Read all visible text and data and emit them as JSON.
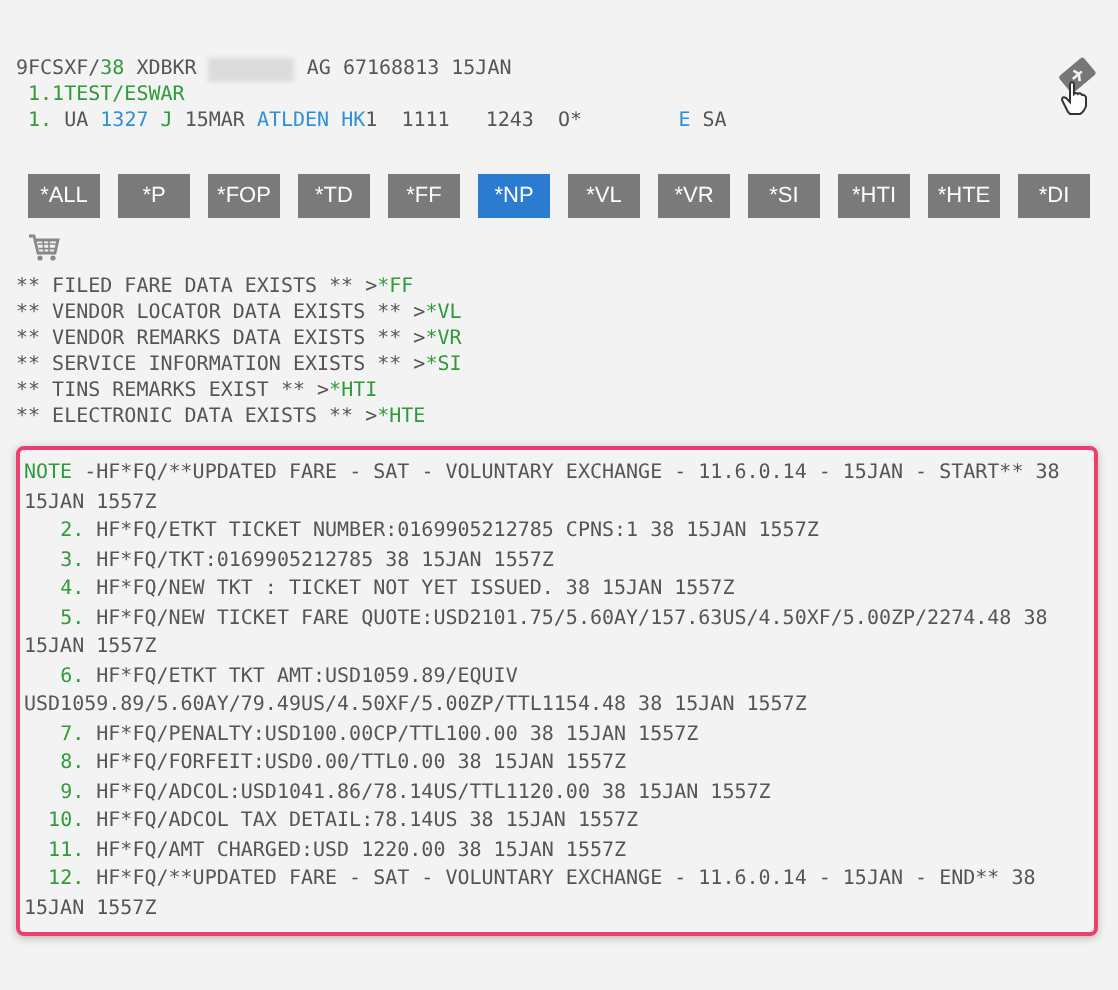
{
  "header_lines": [
    [
      {
        "text": "9FCSXF/",
        "color": "#555555"
      },
      {
        "text": "38",
        "color": "#2e9a3a"
      },
      {
        "text": " XDBKR ",
        "color": "#555555"
      },
      {
        "redacted": true
      },
      {
        "text": " AG 67168813 15JAN",
        "color": "#555555"
      }
    ],
    [
      {
        "text": " 1.1TEST/ESWAR",
        "color": "#2e9a3a"
      }
    ],
    [
      {
        "text": " 1.",
        "color": "#2e9a3a"
      },
      {
        "text": " UA ",
        "color": "#555555"
      },
      {
        "text": "1327",
        "color": "#2f8fd8"
      },
      {
        "text": " J",
        "color": "#2e9a3a"
      },
      {
        "text": " 15MAR ",
        "color": "#555555"
      },
      {
        "text": "ATLDEN HK",
        "color": "#2f8fd8"
      },
      {
        "text": "1  1111   1243  O*        ",
        "color": "#555555"
      },
      {
        "text": "E",
        "color": "#2f8fd8"
      },
      {
        "text": " SA",
        "color": "#555555"
      }
    ]
  ],
  "buttons": [
    {
      "label": "*ALL",
      "selected": false
    },
    {
      "label": "*P",
      "selected": false
    },
    {
      "label": "*FOP",
      "selected": false
    },
    {
      "label": "*TD",
      "selected": false
    },
    {
      "label": "*FF",
      "selected": false
    },
    {
      "label": "*NP",
      "selected": true
    },
    {
      "label": "*VL",
      "selected": false
    },
    {
      "label": "*VR",
      "selected": false
    },
    {
      "label": "*SI",
      "selected": false
    },
    {
      "label": "*HTI",
      "selected": false
    },
    {
      "label": "*HTE",
      "selected": false
    },
    {
      "label": "*DI",
      "selected": false
    }
  ],
  "info_lines": [
    {
      "text": "** FILED FARE DATA EXISTS ** >",
      "command": "*FF"
    },
    {
      "text": "** VENDOR LOCATOR DATA EXISTS ** >",
      "command": "*VL"
    },
    {
      "text": "** VENDOR REMARKS DATA EXISTS ** >",
      "command": "*VR"
    },
    {
      "text": "** SERVICE INFORMATION EXISTS ** >",
      "command": "*SI"
    },
    {
      "text": "** TINS REMARKS EXIST ** >",
      "command": "*HTI"
    },
    {
      "text": "** ELECTRONIC DATA EXISTS ** >",
      "command": "*HTE"
    }
  ],
  "notes": [
    {
      "marker": "NOTE",
      "text": " -HF*FQ/**UPDATED FARE - SAT - VOLUNTARY EXCHANGE - 11.6.0.14 - 15JAN - START** 38 15JAN 1557Z"
    },
    {
      "marker": "   2.",
      "text": " HF*FQ/ETKT TICKET NUMBER:0169905212785 CPNS:1 38 15JAN 1557Z"
    },
    {
      "marker": "   3.",
      "text": " HF*FQ/TKT:0169905212785 38 15JAN 1557Z"
    },
    {
      "marker": "   4.",
      "text": " HF*FQ/NEW TKT : TICKET NOT YET ISSUED. 38 15JAN 1557Z"
    },
    {
      "marker": "   5.",
      "text": " HF*FQ/NEW TICKET FARE QUOTE:USD2101.75/5.60AY/157.63US/4.50XF/5.00ZP/2274.48 38 15JAN 1557Z"
    },
    {
      "marker": "   6.",
      "text": " HF*FQ/ETKT TKT AMT:USD1059.89/EQUIV USD1059.89/5.60AY/79.49US/4.50XF/5.00ZP/TTL1154.48 38 15JAN 1557Z"
    },
    {
      "marker": "   7.",
      "text": " HF*FQ/PENALTY:USD100.00CP/TTL100.00 38 15JAN 1557Z"
    },
    {
      "marker": "   8.",
      "text": " HF*FQ/FORFEIT:USD0.00/TTL0.00 38 15JAN 1557Z"
    },
    {
      "marker": "   9.",
      "text": " HF*FQ/ADCOL:USD1041.86/78.14US/TTL1120.00 38 15JAN 1557Z"
    },
    {
      "marker": "  10.",
      "text": " HF*FQ/ADCOL TAX DETAIL:78.14US 38 15JAN 1557Z"
    },
    {
      "marker": "  11.",
      "text": " HF*FQ/AMT CHARGED:USD 1220.00 38 15JAN 1557Z"
    },
    {
      "marker": "  12.",
      "text": " HF*FQ/**UPDATED FARE - SAT - VOLUNTARY EXCHANGE - 11.6.0.14 - 15JAN - END** 38 15JAN 1557Z"
    }
  ]
}
